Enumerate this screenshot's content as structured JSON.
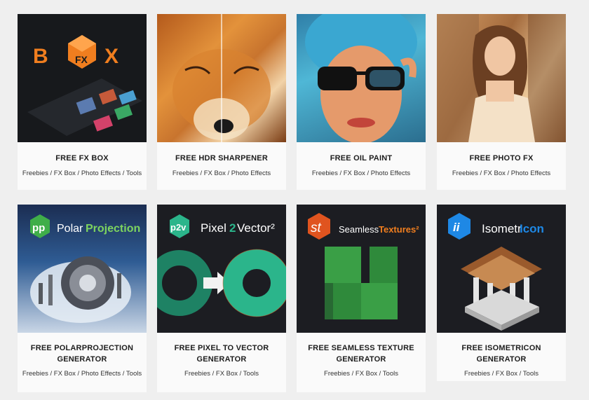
{
  "cards": [
    {
      "title": "FREE FX BOX",
      "cats": "Freebies / FX Box / Photo Effects / Tools",
      "logo": "FX Box",
      "thumb_icon": "fxbox-logo-icon"
    },
    {
      "title": "FREE HDR SHARPENER",
      "cats": "Freebies / FX Box / Photo Effects",
      "thumb_icon": "fox-photo-icon"
    },
    {
      "title": "FREE OIL PAINT",
      "cats": "Freebies / FX Box / Photo Effects",
      "thumb_icon": "oil-paint-portrait-icon"
    },
    {
      "title": "FREE PHOTO FX",
      "cats": "Freebies / FX Box / Photo Effects",
      "thumb_icon": "photo-portrait-icon"
    },
    {
      "title": "FREE POLARPROJECTION GENERATOR",
      "cats": "Freebies / FX Box / Photo Effects / Tools",
      "badge": "pp",
      "name_a": "Polar",
      "name_b": "Projection",
      "thumb_icon": "polar-planet-icon"
    },
    {
      "title": "FREE PIXEL TO VECTOR GENERATOR",
      "cats": "Freebies / FX Box / Tools",
      "badge": "p2v",
      "name_a": "Pixel",
      "name_b": "2",
      "name_c": "Vector²",
      "thumb_icon": "pixel-vector-ring-icon"
    },
    {
      "title": "FREE SEAMLESS TEXTURE GENERATOR",
      "cats": "Freebies / FX Box / Tools",
      "badge": "st",
      "name_a": "Seamless",
      "name_b": "Textures²",
      "thumb_icon": "leaf-texture-icon"
    },
    {
      "title": "FREE ISOMETRICON GENERATOR",
      "cats": "Freebies / FX Box / Tools",
      "badge": "ii",
      "name_a": "Isometr",
      "name_b": "Icon",
      "thumb_icon": "bank-building-icon"
    }
  ],
  "colors": {
    "orange": "#f07e1f",
    "green": "#3fae49",
    "teal": "#2bb58b",
    "blue": "#1e88e5",
    "badge_red": "#e0541f"
  }
}
